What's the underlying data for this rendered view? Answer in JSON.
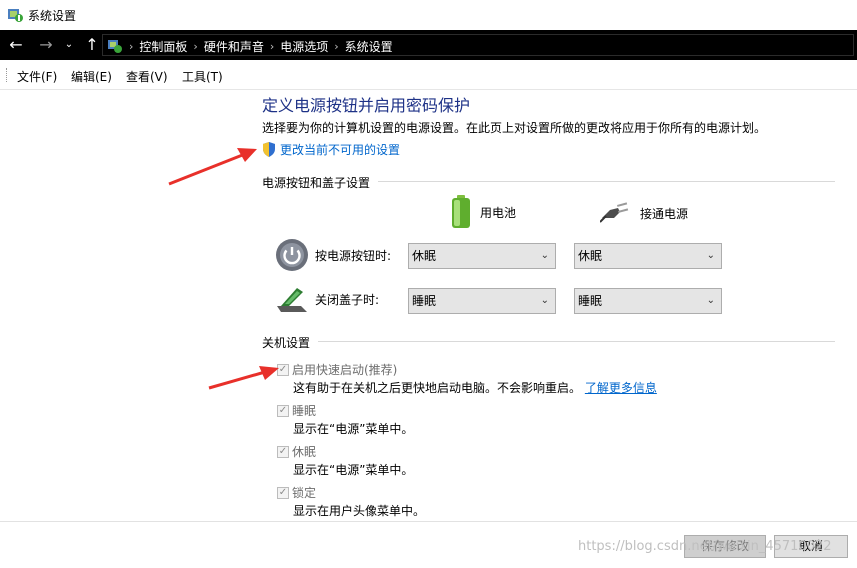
{
  "window": {
    "title": "系统设置"
  },
  "address_bar": {
    "breadcrumbs": [
      "控制面板",
      "硬件和声音",
      "电源选项",
      "系统设置"
    ]
  },
  "menu": {
    "items": [
      "文件(F)",
      "编辑(E)",
      "查看(V)",
      "工具(T)"
    ]
  },
  "page": {
    "title": "定义电源按钮并启用密码保护",
    "description": "选择要为你的计算机设置的电源设置。在此页上对设置所做的更改将应用于你所有的电源计划。",
    "change_link": "更改当前不可用的设置"
  },
  "power_section": {
    "header": "电源按钮和盖子设置",
    "col_battery": "用电池",
    "col_plugged": "接通电源",
    "rows": [
      {
        "label": "按电源按钮时:",
        "battery": "休眠",
        "plugged": "休眠"
      },
      {
        "label": "关闭盖子时:",
        "battery": "睡眠",
        "plugged": "睡眠"
      }
    ]
  },
  "shutdown_section": {
    "header": "关机设置",
    "items": [
      {
        "label": "启用快速启动(推荐)",
        "desc": "这有助于在关机之后更快地启动电脑。不会影响重启。",
        "link": "了解更多信息",
        "checked": true
      },
      {
        "label": "睡眠",
        "desc": "显示在“电源”菜单中。",
        "checked": true
      },
      {
        "label": "休眠",
        "desc": "显示在“电源”菜单中。",
        "checked": true
      },
      {
        "label": "锁定",
        "desc": "显示在用户头像菜单中。",
        "checked": true
      }
    ]
  },
  "buttons": {
    "save": "保存修改",
    "cancel": "取消"
  },
  "watermark": "https://blog.csdn.net/weixin_45710022",
  "colors": {
    "title_blue": "#1e3287",
    "link_blue": "#0066cc",
    "annotation_red": "#e8302a"
  }
}
